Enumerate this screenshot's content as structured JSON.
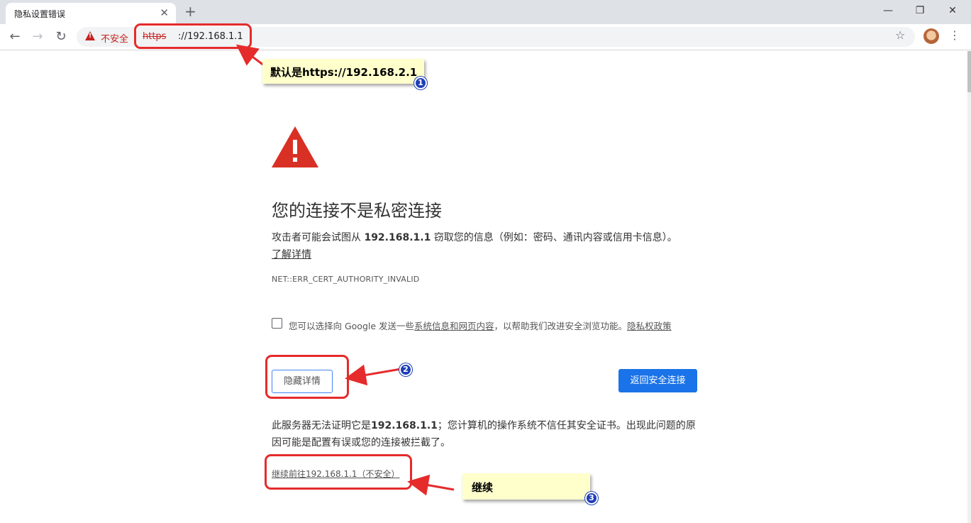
{
  "tab": {
    "title": "隐私设置错误",
    "close": "✕",
    "new_tab": "+"
  },
  "window": {
    "minimize": "—",
    "restore": "❐",
    "close": "✕"
  },
  "toolbar": {
    "back": "←",
    "forward": "→",
    "reload": "↻",
    "insecure_label": "不安全",
    "url_scheme": "https",
    "url_host": "://192.168.1.1",
    "star": "☆",
    "menu": "⋮"
  },
  "interstitial": {
    "heading": "您的连接不是私密连接",
    "desc_prefix": "攻击者可能会试图从 ",
    "desc_host": "192.168.1.1",
    "desc_suffix": " 窃取您的信息（例如：密码、通讯内容或信用卡信息）。",
    "learn_more": "了解详情",
    "error_code": "NET::ERR_CERT_AUTHORITY_INVALID",
    "optin_prefix": "您可以选择向 Google 发送一些",
    "optin_link": "系统信息和网页内容",
    "optin_middle": "，以帮助我们改进安全浏览功能。",
    "optin_privacy": "隐私权政策",
    "hide_details": "隐藏详情",
    "back_to_safety": "返回安全连接",
    "details_prefix": "此服务器无法证明它是",
    "details_host": "192.168.1.1",
    "details_suffix": "；您计算机的操作系统不信任其安全证书。出现此问题的原因可能是配置有误或您的连接被拦截了。",
    "proceed_link": "继续前往192.168.1.1（不安全）"
  },
  "annotations": {
    "callout1": "默认是https://192.168.2.1",
    "callout3": "继续",
    "badge1": "1",
    "badge2": "2",
    "badge3": "3"
  },
  "colors": {
    "annotation_red": "#e52b2b",
    "callout_bg": "#ffffcc",
    "badge_blue": "#1f3fb8",
    "warning_red": "#d93025",
    "primary_button": "#1a73e8"
  },
  "icons": {
    "warning": "warning-triangle-icon",
    "star": "star-icon",
    "menu": "more-vert-icon",
    "avatar": "profile-avatar"
  }
}
